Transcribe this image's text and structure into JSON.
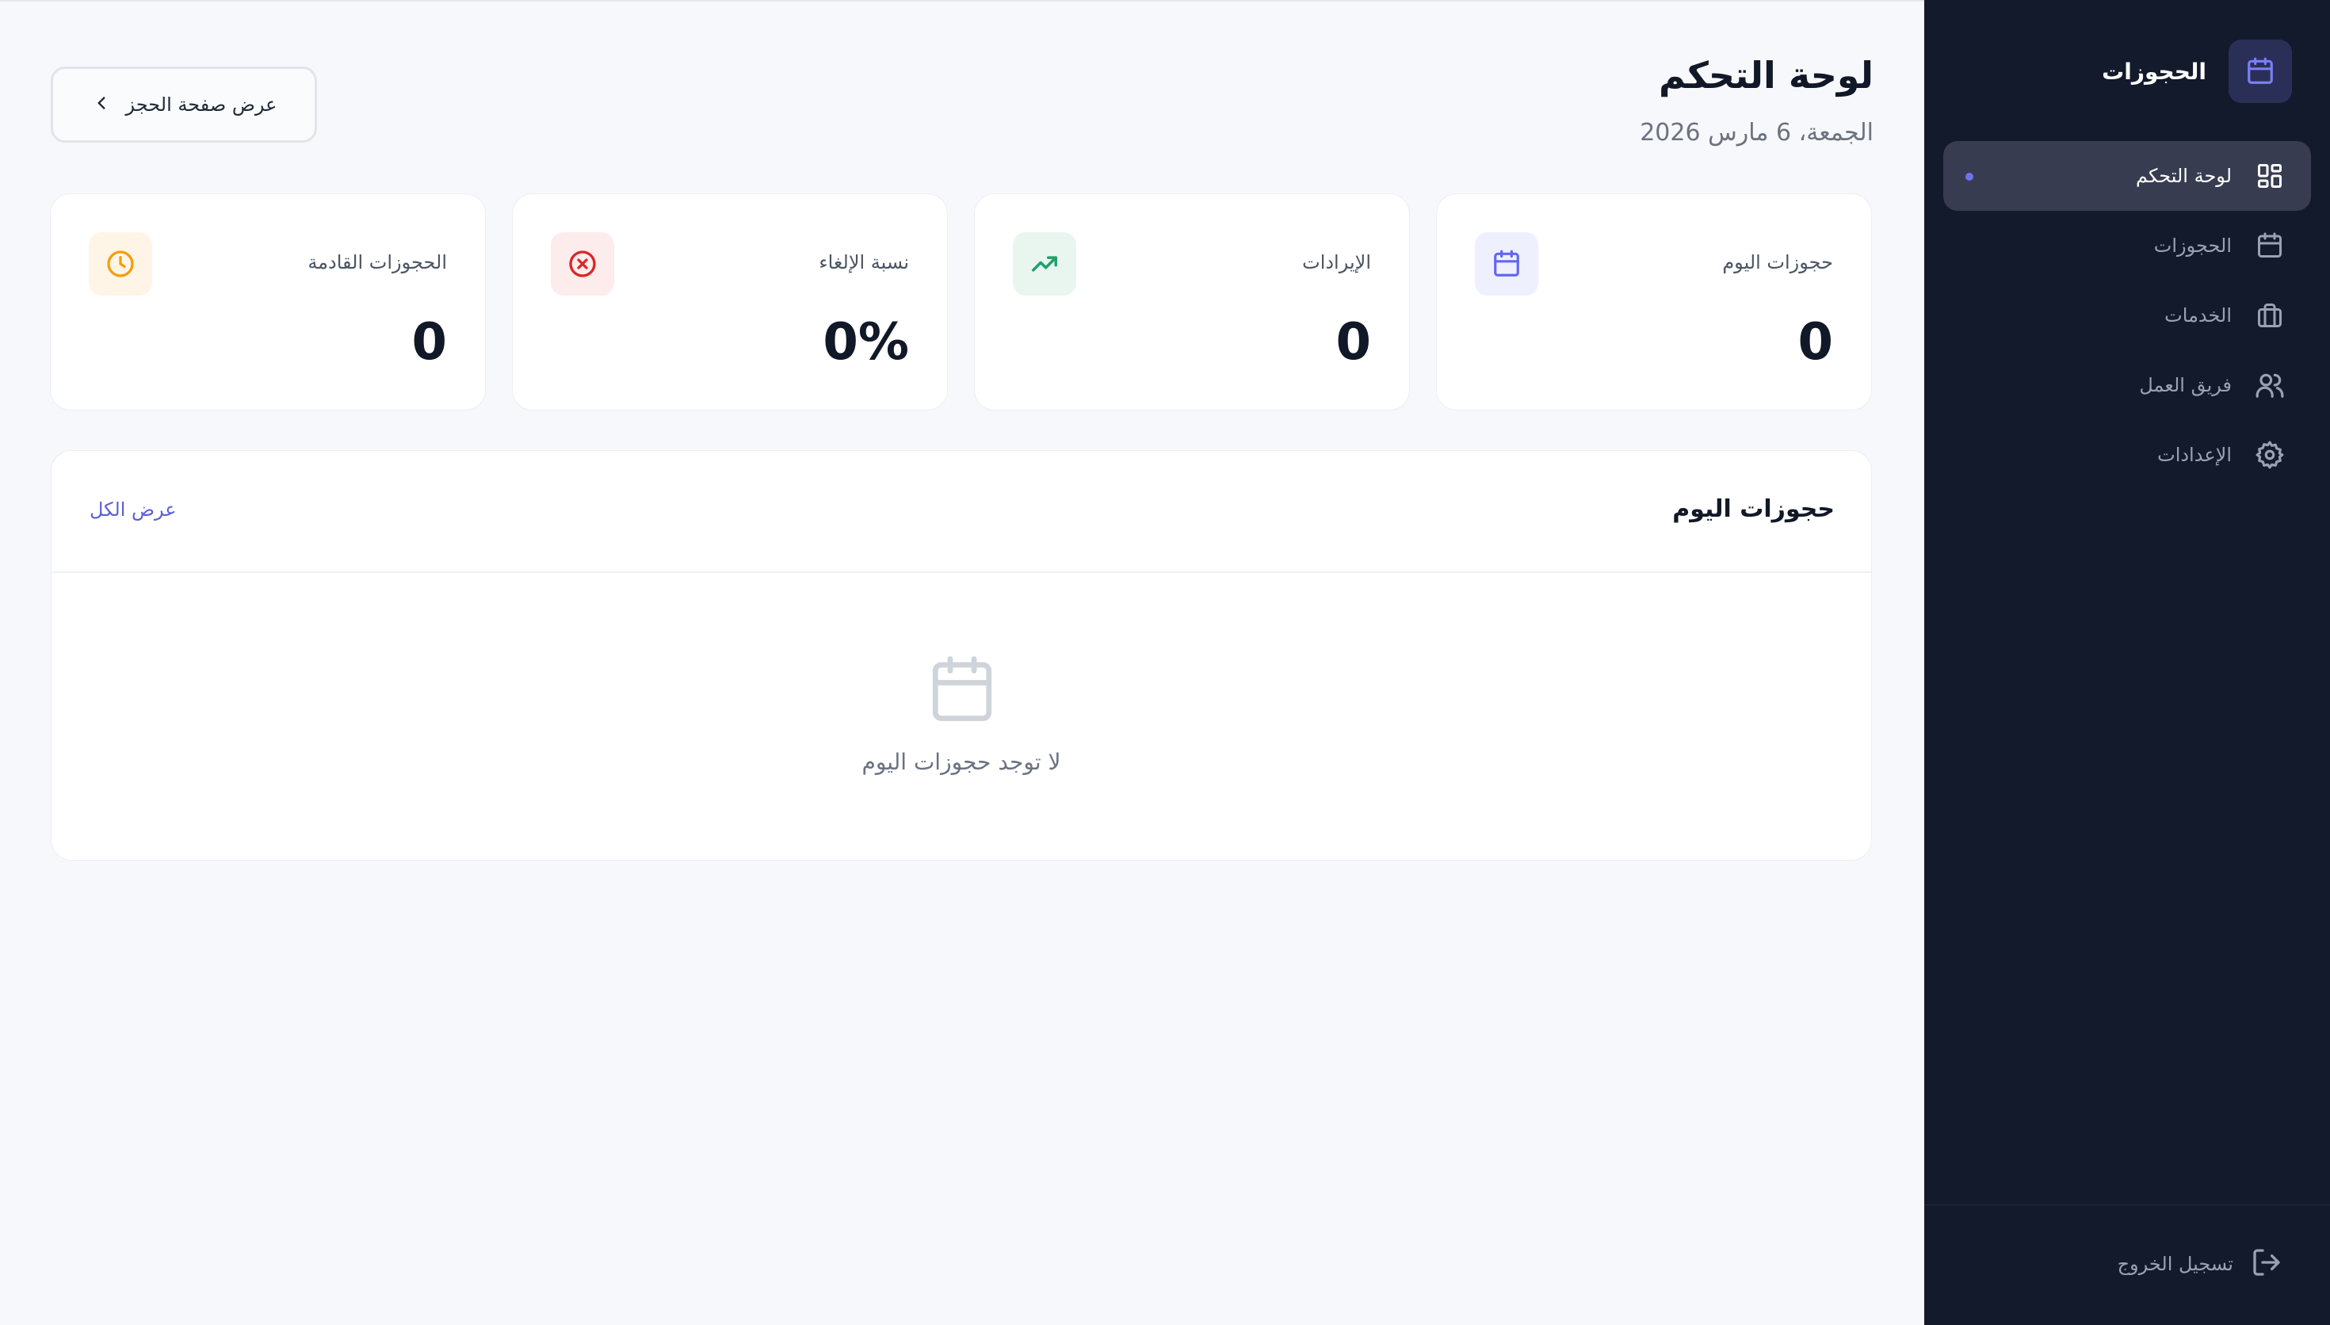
{
  "sidebar": {
    "brand": "الحجوزات",
    "items": [
      {
        "label": "لوحة التحكم",
        "icon": "dashboard-grid-icon",
        "active": true
      },
      {
        "label": "الحجوزات",
        "icon": "calendar-icon",
        "active": false
      },
      {
        "label": "الخدمات",
        "icon": "briefcase-icon",
        "active": false
      },
      {
        "label": "فريق العمل",
        "icon": "users-icon",
        "active": false
      },
      {
        "label": "الإعدادات",
        "icon": "gear-icon",
        "active": false
      }
    ],
    "logout": "تسجيل الخروج"
  },
  "header": {
    "title": "لوحة التحكم",
    "date": "الجمعة، 6 مارس 2026",
    "booking_button": "عرض صفحة الحجز"
  },
  "stats": [
    {
      "label": "حجوزات اليوم",
      "value": "0",
      "icon": "calendar-icon",
      "color": "#6366f1"
    },
    {
      "label": "الإيرادات",
      "value": "0",
      "icon": "trending-up-icon",
      "color": "#22a06b"
    },
    {
      "label": "نسبة الإلغاء",
      "value": "0%",
      "icon": "x-circle-icon",
      "color": "#dc2626"
    },
    {
      "label": "الحجوزات القادمة",
      "value": "0",
      "icon": "clock-icon",
      "color": "#f59e0b"
    }
  ],
  "today_panel": {
    "title": "حجوزات اليوم",
    "view_all": "عرض الكل",
    "empty_text": "لا توجد حجوزات اليوم"
  },
  "colors": {
    "sidebar_bg": "#131a2b",
    "accent": "#6366f1",
    "page_bg": "#f7f8fb"
  }
}
